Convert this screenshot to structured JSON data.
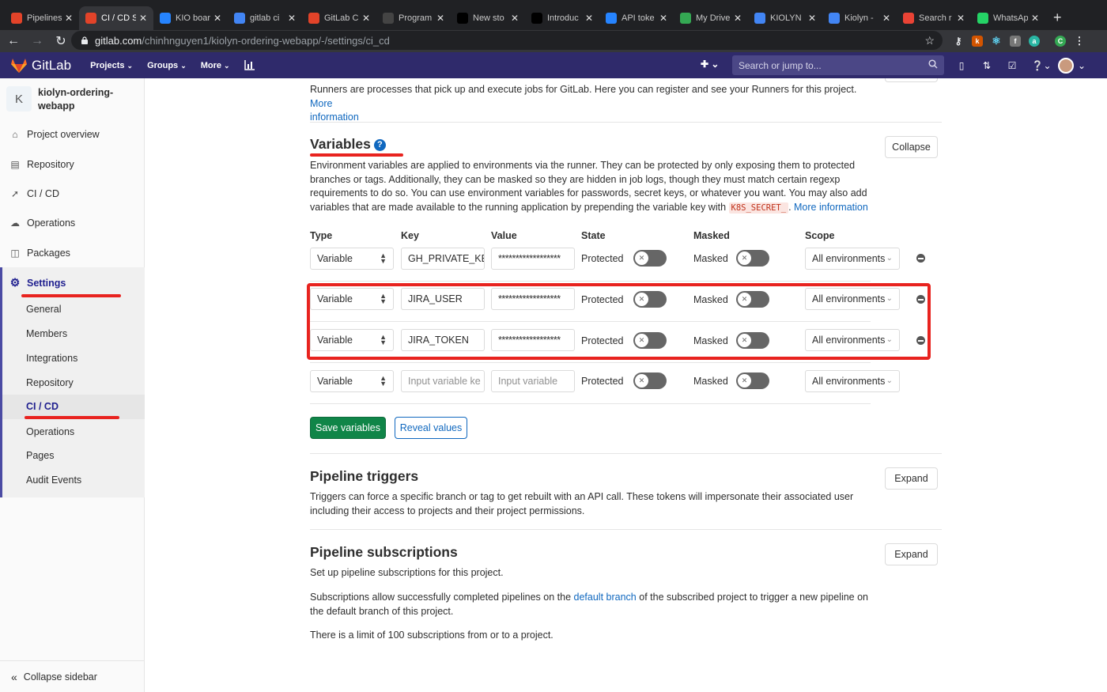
{
  "browser": {
    "tabs": [
      {
        "label": "Pipelines",
        "icon": "gitlab-icon",
        "color": "#e24329",
        "active": false
      },
      {
        "label": "CI / CD S",
        "icon": "gitlab-icon",
        "color": "#e24329",
        "active": true
      },
      {
        "label": "KIO boar",
        "icon": "jira-icon",
        "color": "#2684ff",
        "active": false
      },
      {
        "label": "gitlab ci",
        "icon": "google-icon",
        "color": "#4285f4",
        "active": false
      },
      {
        "label": "GitLab C",
        "icon": "gitlab-icon",
        "color": "#e24329",
        "active": false
      },
      {
        "label": "Program",
        "icon": "github-icon",
        "color": "#444444",
        "active": false
      },
      {
        "label": "New sto",
        "icon": "medium-icon",
        "color": "#000000",
        "active": false
      },
      {
        "label": "Introduc",
        "icon": "medium-icon",
        "color": "#000000",
        "active": false
      },
      {
        "label": "API toke",
        "icon": "atlassian-icon",
        "color": "#2684ff",
        "active": false
      },
      {
        "label": "My Drive",
        "icon": "drive-icon",
        "color": "#34a853",
        "active": false
      },
      {
        "label": "KIOLYN",
        "icon": "docs-icon",
        "color": "#4285f4",
        "active": false
      },
      {
        "label": "Kiolyn -",
        "icon": "docs-icon",
        "color": "#4285f4",
        "active": false
      },
      {
        "label": "Search r",
        "icon": "gmail-icon",
        "color": "#ea4335",
        "active": false
      },
      {
        "label": "WhatsAp",
        "icon": "whatsapp-icon",
        "color": "#25d366",
        "active": false
      }
    ],
    "new_tab": "+",
    "url_host": "gitlab.com",
    "url_path": "/chinhnguyen1/kiolyn-ordering-webapp/-/settings/ci_cd"
  },
  "gitlab": {
    "logo_text": "GitLab",
    "nav": [
      "Projects",
      "Groups",
      "More"
    ],
    "search_placeholder": "Search or jump to..."
  },
  "sidebar": {
    "project_initial": "K",
    "project_name": "kiolyn-ordering-webapp",
    "items": [
      "Project overview",
      "Repository",
      "CI / CD",
      "Operations",
      "Packages",
      "Settings"
    ],
    "settings_sub": [
      "General",
      "Members",
      "Integrations",
      "Repository",
      "CI / CD",
      "Operations",
      "Pages",
      "Audit Events"
    ],
    "collapse": "Collapse sidebar"
  },
  "runners": {
    "text": "Runners are processes that pick up and execute jobs for GitLab. Here you can register and see your Runners for this project.",
    "more": "More",
    "more2": "information"
  },
  "variables": {
    "title": "Variables",
    "collapse_btn": "Collapse",
    "desc_line1": "Environment variables are applied to environments via the runner. They can be protected by only exposing them to protected",
    "desc_line2": "branches or tags. Additionally, they can be masked so they are hidden in job logs, though they must match certain regexp",
    "desc_line3": "requirements to do so. You can use environment variables for passwords, secret keys, or whatever you want. You may also add",
    "desc_line4": "variables that are made available to the running application by prepending the variable key with",
    "k8s_prefix": "K8S_SECRET_",
    "more_info": "More information",
    "headers": {
      "type": "Type",
      "key": "Key",
      "value": "Value",
      "state": "State",
      "masked": "Masked",
      "scope": "Scope"
    },
    "rows": [
      {
        "type": "Variable",
        "key": "GH_PRIVATE_KE",
        "value": "******************",
        "state": "Protected",
        "masked": "Masked",
        "scope": "All environments"
      },
      {
        "type": "Variable",
        "key": "JIRA_USER",
        "value": "******************",
        "state": "Protected",
        "masked": "Masked",
        "scope": "All environments"
      },
      {
        "type": "Variable",
        "key": "JIRA_TOKEN",
        "value": "******************",
        "state": "Protected",
        "masked": "Masked",
        "scope": "All environments"
      }
    ],
    "new_row": {
      "type": "Variable",
      "key_placeholder": "Input variable ke",
      "value_placeholder": "Input variable",
      "state": "Protected",
      "masked": "Masked",
      "scope": "All environments"
    },
    "save_btn": "Save variables",
    "reveal_btn": "Reveal values"
  },
  "triggers": {
    "title": "Pipeline triggers",
    "expand_btn": "Expand",
    "desc_line1": "Triggers can force a specific branch or tag to get rebuilt with an API call. These tokens will impersonate their associated user",
    "desc_line2": "including their access to projects and their project permissions."
  },
  "subscriptions": {
    "title": "Pipeline subscriptions",
    "expand_btn": "Expand",
    "p1": "Set up pipeline subscriptions for this project.",
    "p2_a": "Subscriptions allow successfully completed pipelines on the",
    "p2_link": "default branch",
    "p2_b": "of the subscribed project to trigger a new pipeline on",
    "p2_c": "the default branch of this project.",
    "p3": "There is a limit of 100 subscriptions from or to a project."
  },
  "colors": {
    "gitlab_header": "#2f2a6b",
    "save_green": "#108548",
    "annotation_red": "#e8231f",
    "link_blue": "#1068bf"
  }
}
